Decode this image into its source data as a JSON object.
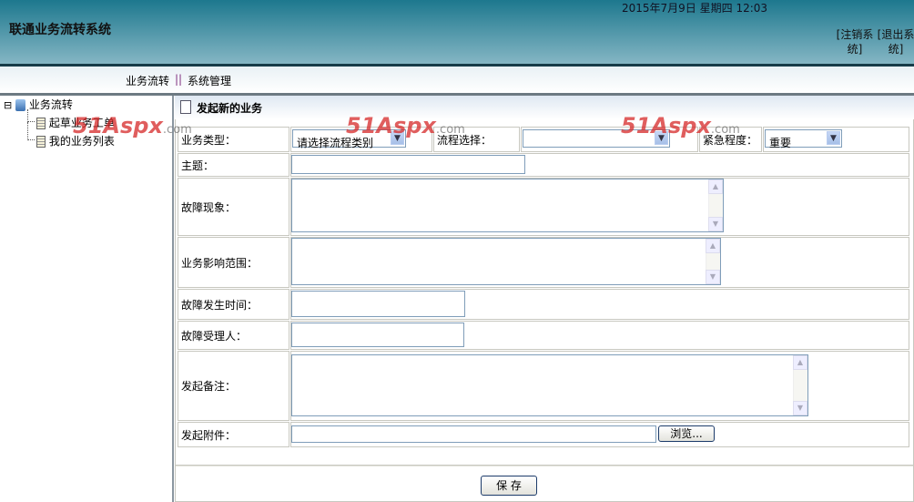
{
  "header": {
    "title": "联通业务流转系统",
    "datetime": "2015年7月9日  星期四  12:03",
    "logout_label": "[注销系统]",
    "exit_label": "[退出系统]"
  },
  "nav": {
    "items": [
      "业务流转",
      "系统管理"
    ],
    "separator": "||"
  },
  "sidebar": {
    "root": "业务流转",
    "items": [
      "起草业务工单",
      "我的业务列表"
    ],
    "collapse_glyph": "⊟"
  },
  "panel": {
    "title": "发起新的业务"
  },
  "form": {
    "business_type_label": "业务类型：",
    "business_type_value": "请选择流程类别",
    "flow_label": "流程选择：",
    "flow_value": "",
    "urgency_label": "紧急程度：",
    "urgency_value": "重要",
    "subject_label": "主题：",
    "symptom_label": "故障现象：",
    "impact_label": "业务影响范围：",
    "time_label": "故障发生时间：",
    "handler_label": "故障受理人：",
    "remark_label": "发起备注：",
    "attachment_label": "发起附件：",
    "browse_label": "浏览...",
    "save_label": "保 存"
  },
  "watermark": {
    "text": "51Aspx",
    ".com": ".com"
  }
}
